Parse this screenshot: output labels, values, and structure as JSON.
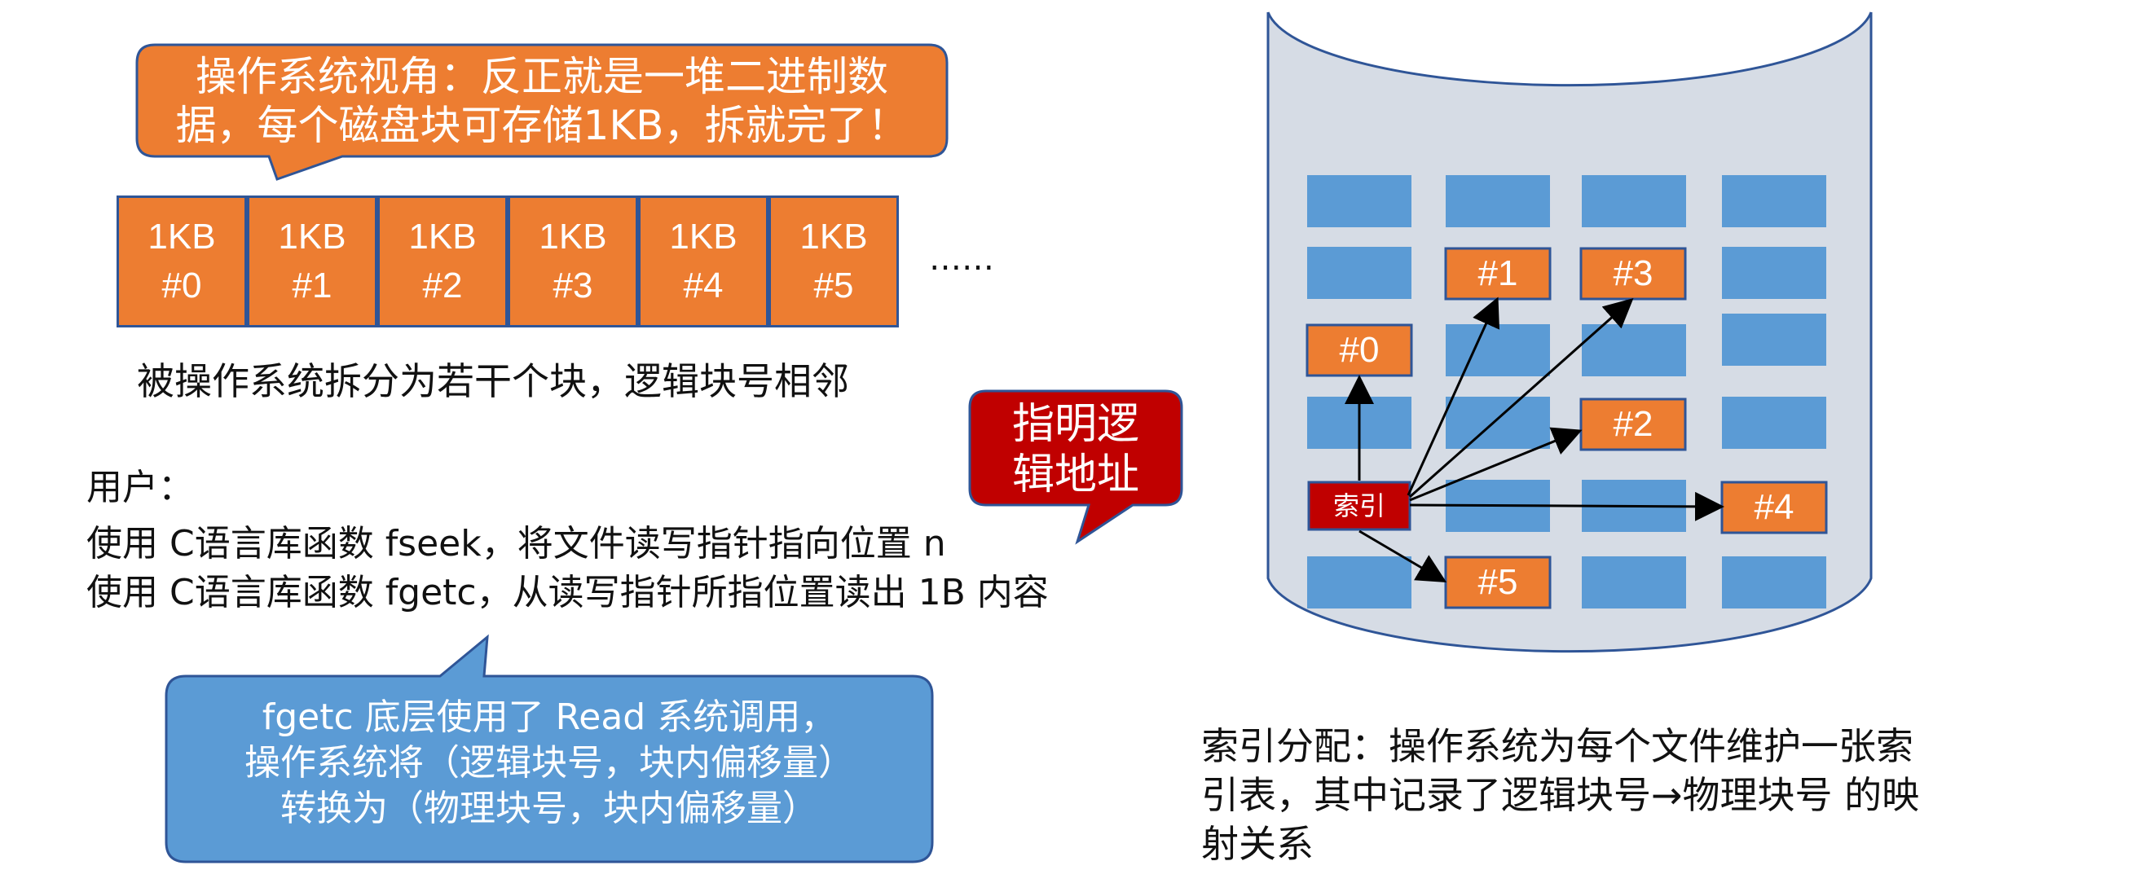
{
  "os_callout": {
    "line1": "操作系统视角：反正就是一堆二进制数",
    "line2": "据，每个磁盘块可存储1KB，拆就完了！"
  },
  "logical_blocks": [
    {
      "size": "1KB",
      "id": "#0"
    },
    {
      "size": "1KB",
      "id": "#1"
    },
    {
      "size": "1KB",
      "id": "#2"
    },
    {
      "size": "1KB",
      "id": "#3"
    },
    {
      "size": "1KB",
      "id": "#4"
    },
    {
      "size": "1KB",
      "id": "#5"
    }
  ],
  "ellipsis": "……",
  "split_caption": "被操作系统拆分为若干个块，逻辑块号相邻",
  "user_text": {
    "heading": "用户：",
    "line1": "使用 C语言库函数 fseek，将文件读写指针指向位置 n",
    "line2": "使用 C语言库函数 fgetc，从读写指针所指位置读出 1B 内容"
  },
  "logical_addr_callout": {
    "line1": "指明逻",
    "line2": "辑地址"
  },
  "fgetc_callout": {
    "line1": "fgetc 底层使用了 Read 系统调用，",
    "line2": "操作系统将（逻辑块号，块内偏移量）",
    "line3": "转换为（物理块号，块内偏移量）"
  },
  "disk": {
    "index_label": "索引",
    "blocks": [
      "#0",
      "#1",
      "#2",
      "#3",
      "#4",
      "#5"
    ]
  },
  "index_caption": {
    "line1": "索引分配：操作系统为每个文件维护一张索",
    "line2": "引表，其中记录了逻辑块号→物理块号 的映",
    "line3": "射关系"
  },
  "colors": {
    "orange": "#ed7d31",
    "blue": "#5b9bd5",
    "dark_red": "#c00000",
    "disk_gray": "#d6dce5",
    "border_blue": "#2f5597"
  }
}
